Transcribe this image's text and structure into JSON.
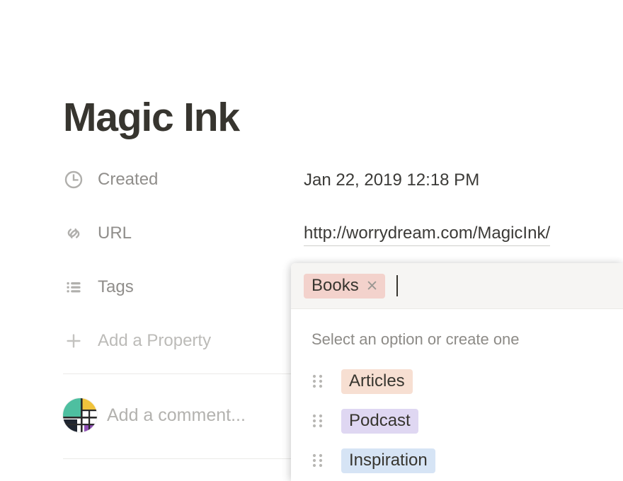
{
  "page": {
    "title": "Magic Ink"
  },
  "properties": [
    {
      "icon": "clock-icon",
      "label": "Created",
      "value": "Jan 22, 2019 12:18 PM",
      "value_kind": "text"
    },
    {
      "icon": "link-icon",
      "label": "URL",
      "value": "http://worrydream.com/MagicInk/",
      "value_kind": "link"
    },
    {
      "icon": "list-icon",
      "label": "Tags",
      "value": "",
      "value_kind": "tags"
    },
    {
      "icon": "plus-icon",
      "label": "Add a Property",
      "value": "",
      "value_kind": "none"
    }
  ],
  "comment": {
    "avatar": "mondrian-avatar",
    "placeholder": "Add a comment..."
  },
  "tag_popup": {
    "selected_tags": [
      {
        "label": "Books",
        "color": "#F3D2CC",
        "remove_icon": "close-icon"
      }
    ],
    "hint": "Select an option or create one",
    "options": [
      {
        "label": "Articles",
        "color": "#F7DFD2",
        "handle_icon": "drag-handle-icon"
      },
      {
        "label": "Podcast",
        "color": "#DFD7F2",
        "handle_icon": "drag-handle-icon"
      },
      {
        "label": "Inspiration",
        "color": "#D6E4F5",
        "handle_icon": "drag-handle-icon"
      }
    ]
  },
  "colors": {
    "title_text": "#37352F",
    "label_text": "#908E8B",
    "faint_text": "#BCBBB8",
    "value_text": "#3B3A37",
    "popup_header_bg": "#F6F5F3",
    "divider": "#EBEAE8"
  }
}
